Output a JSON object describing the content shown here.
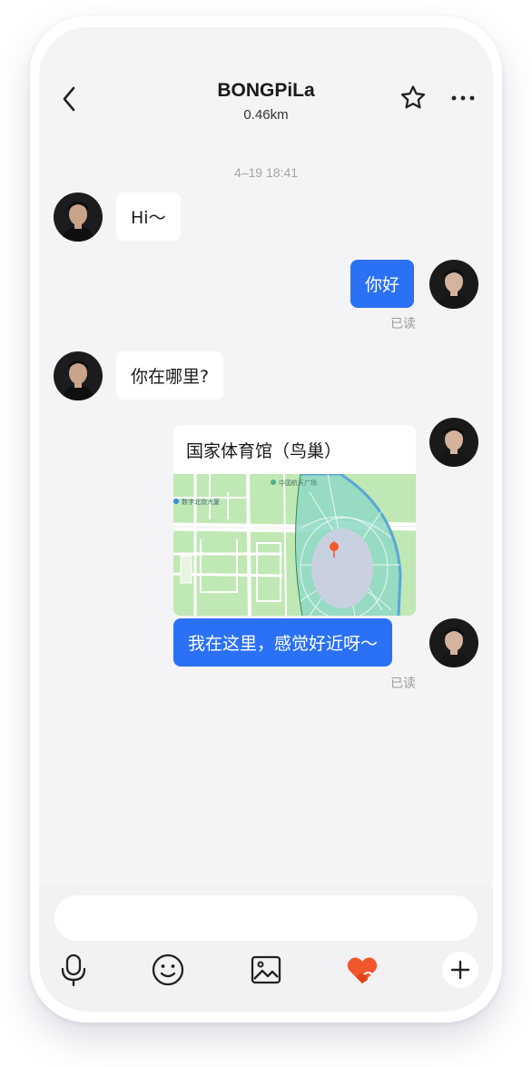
{
  "header": {
    "title": "BONGPiLa",
    "distance": "0.46km",
    "icons": [
      "back-icon",
      "star-icon",
      "more-icon"
    ]
  },
  "conversation": {
    "timestamp": "4–19 18:41",
    "messages": [
      {
        "from": "contact",
        "type": "text",
        "text": "Hi～"
      },
      {
        "from": "me",
        "type": "text",
        "text": "你好",
        "status": "已读"
      },
      {
        "from": "contact",
        "type": "text",
        "text": "你在哪里?"
      },
      {
        "from": "me",
        "type": "location",
        "text": "国家体育馆（鸟巢）",
        "map_labels": [
          "中国航天广场",
          "数字北京大厦"
        ]
      },
      {
        "from": "me",
        "type": "text",
        "text": "我在这里，感觉好近呀～",
        "status": "已读"
      }
    ]
  },
  "composer": {
    "input_value": "",
    "input_placeholder": "",
    "tools": [
      "microphone-icon",
      "emoji-icon",
      "image-icon",
      "heart-icon",
      "plus-icon"
    ]
  },
  "colors": {
    "accent": "#2b71f5",
    "heart": "#f2562b",
    "background": "#f4f4f6"
  }
}
